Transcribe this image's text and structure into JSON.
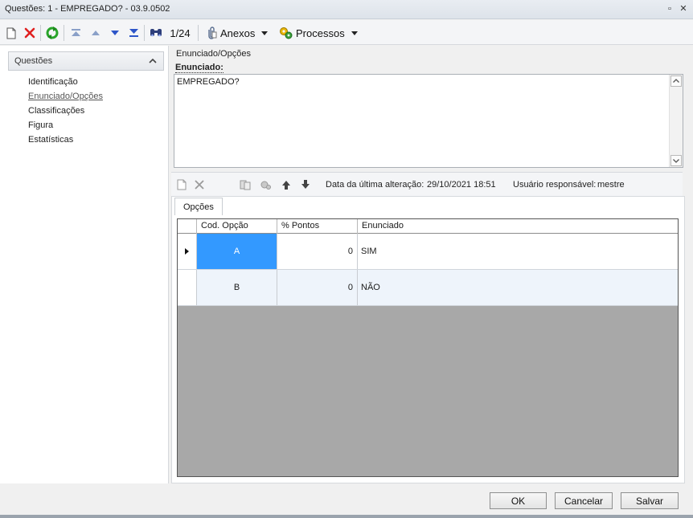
{
  "window": {
    "title": "Questões: 1 - EMPREGADO? - 03.9.0502",
    "restore_glyph": "▫",
    "close_glyph": "✕"
  },
  "toolbar": {
    "record_position": "1/24",
    "attachments_label": "Anexos",
    "processes_label": "Processos",
    "icons": [
      "new-record-icon",
      "delete-icon",
      "refresh-icon",
      "first-record-icon",
      "previous-record-icon",
      "next-record-icon",
      "last-record-icon",
      "find-icon",
      "paperclip-icon",
      "processes-icon"
    ]
  },
  "sidebar": {
    "header": "Questões",
    "items": [
      {
        "label": "Identificação"
      },
      {
        "label": "Enunciado/Opções"
      },
      {
        "label": "Classificações"
      },
      {
        "label": "Figura"
      },
      {
        "label": "Estatísticas"
      }
    ],
    "active_index": 1
  },
  "main": {
    "group_label": "Enunciado/Opções",
    "statement_label": "Enunciado:",
    "statement_value": "EMPREGADO?"
  },
  "subtoolbar": {
    "last_change_label": "Data da última alteração:",
    "last_change_value": "29/10/2021 18:51",
    "responsible_label": "Usuário responsável:",
    "responsible_value": "mestre"
  },
  "options": {
    "tab_label": "Opções",
    "columns": [
      "Cod. Opção",
      "% Pontos",
      "Enunciado"
    ],
    "rows": [
      {
        "code": "A",
        "points": "0",
        "statement": "SIM"
      },
      {
        "code": "B",
        "points": "0",
        "statement": "NÃO"
      }
    ],
    "selected_index": 0
  },
  "buttons": {
    "ok": "OK",
    "cancel": "Cancelar",
    "save": "Salvar"
  },
  "colors": {
    "selected_cell": "#3399ff",
    "alt_row": "#eef4fb",
    "grid_empty": "#a8a8a8"
  }
}
